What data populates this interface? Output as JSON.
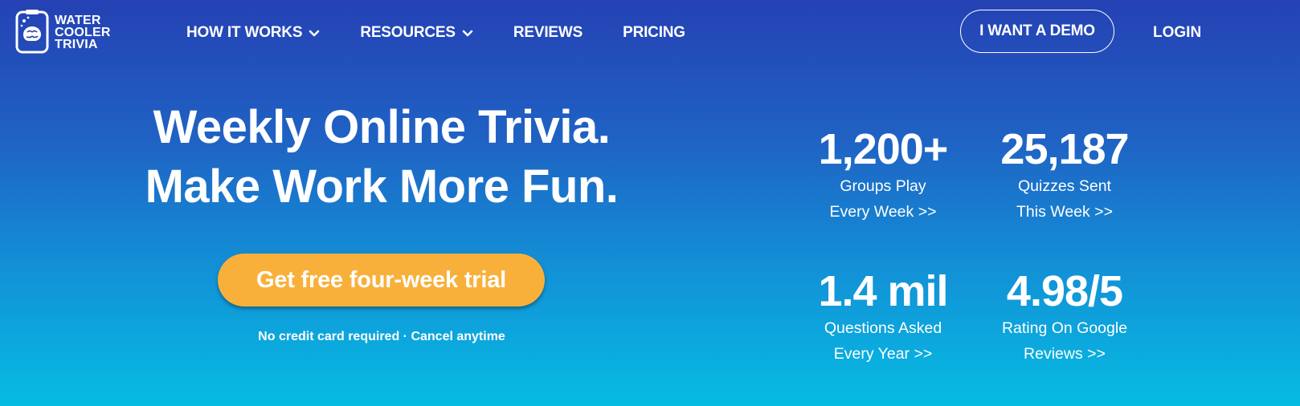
{
  "brand": {
    "logo_lines": [
      "WATER",
      "COOLER",
      "TRIVIA"
    ],
    "logo_icon": "brain-water-cooler-icon"
  },
  "nav": {
    "items": [
      {
        "label": "HOW IT WORKS",
        "has_dropdown": true
      },
      {
        "label": "RESOURCES",
        "has_dropdown": true
      },
      {
        "label": "REVIEWS",
        "has_dropdown": false
      },
      {
        "label": "PRICING",
        "has_dropdown": false
      }
    ],
    "demo_button": "I WANT A DEMO",
    "login": "LOGIN"
  },
  "hero": {
    "headline_line1": "Weekly Online Trivia.",
    "headline_line2": "Make Work More Fun.",
    "cta": "Get free four-week trial",
    "subnote": "No credit card required · Cancel anytime"
  },
  "stats": [
    {
      "value": "1,200+",
      "line1": "Groups Play",
      "line2": "Every Week >>"
    },
    {
      "value": "25,187",
      "line1": "Quizzes Sent",
      "line2": "This Week >>"
    },
    {
      "value": "1.4 mil",
      "line1": "Questions Asked",
      "line2": "Every Year >>"
    },
    {
      "value": "4.98/5",
      "line1": "Rating On Google",
      "line2": "Reviews >>"
    }
  ],
  "colors": {
    "gradient_top": "#2541b4",
    "gradient_bottom": "#06bce3",
    "cta_background": "#f9b03a",
    "text": "#ffffff"
  }
}
